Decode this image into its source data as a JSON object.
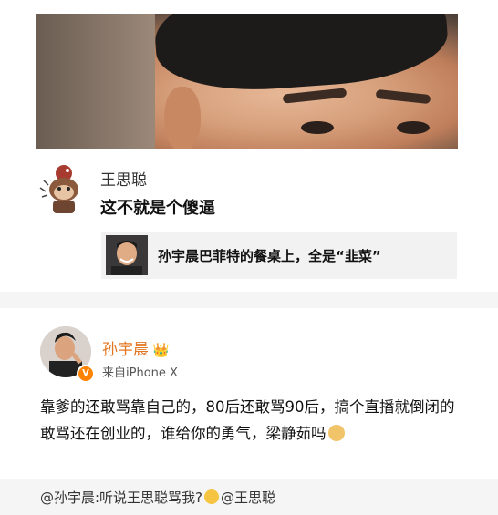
{
  "comment": {
    "author": "王思聪",
    "text": "这不就是个傻逼"
  },
  "quoted_post": {
    "text": "孙宇晨巴菲特的餐桌上，全是“韭菜”"
  },
  "post": {
    "author": "孙宇晨",
    "source": "来自iPhone X",
    "verified_badge": "V",
    "body": "靠爹的还敢骂靠自己的，80后还敢骂90后，搞个直播就倒闭的敢骂还在创业的，谁给你的勇气，梁静茹吗",
    "emoji": "doge-emoji"
  },
  "repost": {
    "prefix": "@孙宇晨:听说王思聪骂我?",
    "mention": "@王思聪",
    "emoji": "smile-emoji"
  },
  "colors": {
    "author_orange": "#e37621",
    "badge_orange": "#ff8200",
    "panel_gray": "#f2f2f2"
  }
}
